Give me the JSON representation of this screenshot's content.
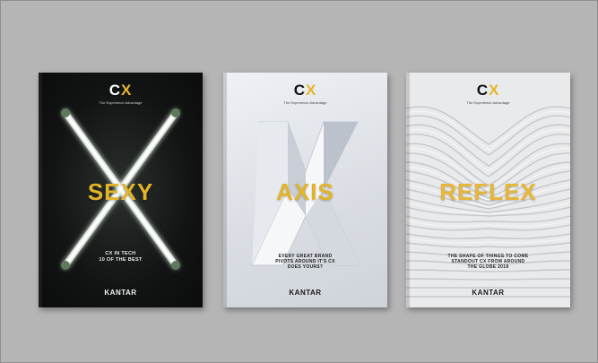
{
  "books": [
    {
      "logo_c": "C",
      "logo_x": "X",
      "subtitle": "The Experience Advantage",
      "word": "SEXY",
      "tagline_line1": "CX IN TECH",
      "tagline_line2": "10 OF THE BEST",
      "brand": "KANTAR"
    },
    {
      "logo_c": "C",
      "logo_x": "X",
      "subtitle": "The Experience Advantage",
      "word": "AXIS",
      "tagline_line1": "EVERY GREAT BRAND",
      "tagline_line2": "PIVOTS AROUND IT'S CX",
      "tagline_line3": "DOES YOURS?",
      "brand": "KANTAR"
    },
    {
      "logo_c": "C",
      "logo_x": "X",
      "subtitle": "The Experience Advantage",
      "word": "REFLEX",
      "tagline_line1": "THE SHAPE OF THINGS TO COME",
      "tagline_line2": "STANDOUT CX FROM AROUND",
      "tagline_line3": "THE GLOBE 2018",
      "brand": "KANTAR"
    }
  ],
  "colors": {
    "background": "#b5b5b5",
    "accent": "#e3b42a",
    "dark_cover": "#121414",
    "light_cover": "#e9eaec"
  }
}
